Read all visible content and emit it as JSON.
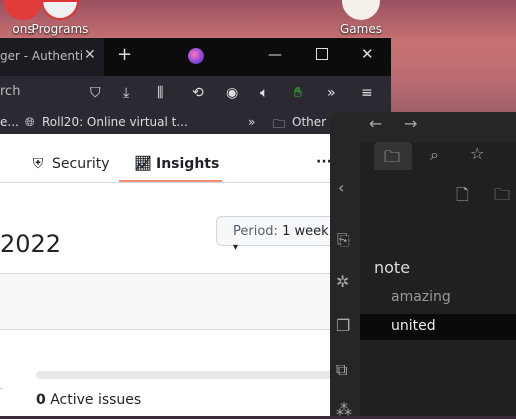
{
  "desktop": {
    "icons": [
      {
        "label": "ons"
      },
      {
        "label": "Programs"
      },
      {
        "label": "Games"
      }
    ]
  },
  "firefox": {
    "tab_title": "ger - Authentica",
    "new_tab": "+",
    "address_placeholder": "rch",
    "bookmarks": [
      {
        "label": "e..."
      },
      {
        "label": "Roll20: Online virtual t..."
      },
      {
        "label": "Other B"
      }
    ]
  },
  "github": {
    "tabs": [
      {
        "label": "Security"
      },
      {
        "label": "Insights"
      }
    ],
    "more": "···",
    "heading": "2022",
    "period_label": "Period:",
    "period_value": "1 week",
    "active_issues_count": "0",
    "active_issues_label": "Active issues"
  },
  "obsidian": {
    "folder": "note",
    "files": [
      {
        "label": "amazing"
      },
      {
        "label": "united"
      }
    ]
  }
}
